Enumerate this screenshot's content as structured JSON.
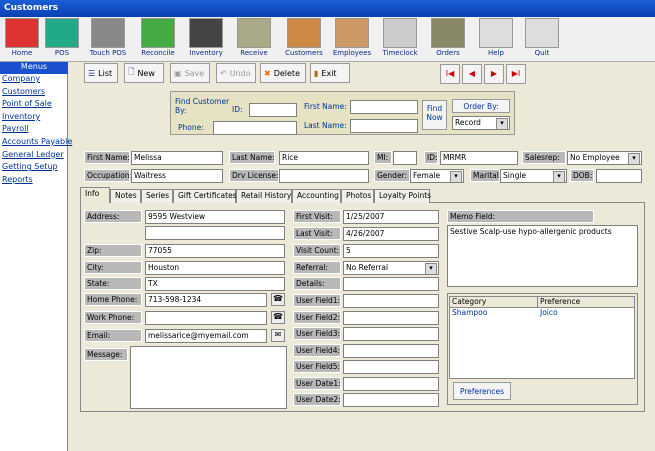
{
  "window": {
    "title": "Customers"
  },
  "toolbar": [
    {
      "label": "Home",
      "name": "home"
    },
    {
      "label": "POS",
      "name": "pos"
    },
    {
      "label": "Touch POS",
      "name": "touch-pos"
    },
    {
      "label": "Reconcile",
      "name": "reconcile"
    },
    {
      "label": "Inventory",
      "name": "inventory"
    },
    {
      "label": "Receive",
      "name": "receive"
    },
    {
      "label": "Customers",
      "name": "customers"
    },
    {
      "label": "Employees",
      "name": "employees"
    },
    {
      "label": "Timeclock",
      "name": "timeclock"
    },
    {
      "label": "Orders",
      "name": "orders"
    },
    {
      "label": "Help",
      "name": "help"
    },
    {
      "label": "Quit",
      "name": "quit"
    }
  ],
  "menus": {
    "header": "Menus",
    "items": [
      "Company",
      "Customers",
      "Point of Sale",
      "Inventory",
      "Payroll",
      "Accounts Payable",
      "General Ledger",
      "Getting Setup",
      "Reports"
    ]
  },
  "actions": {
    "list": "List",
    "new": "New",
    "save": "Save",
    "undo": "Undo",
    "delete": "Delete",
    "exit": "Exit"
  },
  "nav": {
    "first": "I◀",
    "prev": "◀",
    "next": "▶",
    "last": "▶I"
  },
  "find": {
    "title": "Find Customer By:",
    "id": "ID:",
    "phone": "Phone:",
    "first": "First Name:",
    "last": "Last Name:",
    "find_btn": "Find Now",
    "order_label": "Order By:",
    "order_value": "Record"
  },
  "customer": {
    "first_name_lbl": "First Name:",
    "first_name": "Melissa",
    "last_name_lbl": "Last Name:",
    "last_name": "Rice",
    "mi_lbl": "MI:",
    "mi": "",
    "id_lbl": "ID:",
    "id": "MRMR",
    "salesrep_lbl": "Salesrep:",
    "salesrep": "No Employee",
    "occupation_lbl": "Occupation:",
    "occupation": "Waitress",
    "license_lbl": "Drv License:",
    "license": "",
    "gender_lbl": "Gender:",
    "gender": "Female",
    "marital_lbl": "Marital:",
    "marital": "Single",
    "dob_lbl": "DOB:",
    "dob": ""
  },
  "tabs": [
    "Info",
    "Notes",
    "Series",
    "Gift Certificates",
    "Retail History",
    "Accounting",
    "Photos",
    "Loyalty Points"
  ],
  "info": {
    "address_lbl": "Address:",
    "address": "9595 Westview",
    "zip_lbl": "Zip:",
    "zip": "77055",
    "city_lbl": "City:",
    "city": "Houston",
    "state_lbl": "State:",
    "state": "TX",
    "home_phone_lbl": "Home Phone:",
    "home_phone": "713-598-1234",
    "work_phone_lbl": "Work Phone:",
    "work_phone": "",
    "email_lbl": "Email:",
    "email": "melissarice@myemail.com",
    "message_lbl": "Message:",
    "first_visit_lbl": "First Visit:",
    "first_visit": "1/25/2007",
    "last_visit_lbl": "Last Visit:",
    "last_visit": "4/26/2007",
    "visit_count_lbl": "Visit Count:",
    "visit_count": "5",
    "referral_lbl": "Referral:",
    "referral": "No Referral",
    "details_lbl": "Details:",
    "uf1": "User Field1:",
    "uf2": "User Field2:",
    "uf3": "User Field3:",
    "uf4": "User Field4:",
    "uf5": "User Field5:",
    "ud1": "User Date1:",
    "ud2": "User Date2:",
    "memo_lbl": "Memo Field:",
    "memo": "Sestive Scalp-use hypo-allergenic products",
    "pref_cols": [
      "Category",
      "Preference"
    ],
    "pref_rows": [
      [
        "Shampoo",
        "Joico"
      ]
    ],
    "pref_btn": "Preferences"
  }
}
